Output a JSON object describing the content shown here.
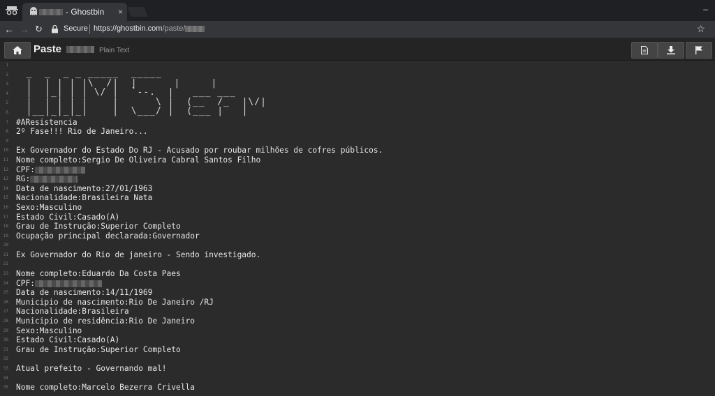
{
  "browser": {
    "tab_title": "- Ghostbin",
    "tab_close": "×",
    "window_controls": "_",
    "secure_label": "Secure",
    "url_host": "https://ghostbin.com",
    "url_path": "/paste/"
  },
  "header": {
    "title": "Paste",
    "language": "Plain Text"
  },
  "ascii_art": [
    "  _  _  _ _ _____  _____",
    "  |  | | | |\\  /|  |      |     |",
    "  |  |_| | | \\/ |  `--.  |   ___ ___",
    "  |  | | | |    |      \\ |  (__  /_  |\\/|",
    "  |__|_|_|_|    |  \\___/ |  (___ |   |"
  ],
  "lines": [
    {
      "n": "1",
      "t": ""
    },
    {
      "n": "2",
      "t": ""
    },
    {
      "n": "3",
      "t": ""
    },
    {
      "n": "4",
      "t": ""
    },
    {
      "n": "5",
      "t": ""
    },
    {
      "n": "6",
      "t": ""
    },
    {
      "n": "7",
      "t": "#AResistencia"
    },
    {
      "n": "8",
      "t": "2º Fase!!! Rio de Janeiro..."
    },
    {
      "n": "9",
      "t": ""
    },
    {
      "n": "10",
      "t": "Ex Governador do Estado Do RJ - Acusado por roubar milhões de cofres públicos."
    },
    {
      "n": "11",
      "t": "Nome completo:Sergio De Oliveira Cabral Santos Filho"
    },
    {
      "n": "12",
      "t": "CPF:",
      "redact": 72
    },
    {
      "n": "13",
      "t": "RG:",
      "redact": 68
    },
    {
      "n": "14",
      "t": "Data de nascimento:27/01/1963"
    },
    {
      "n": "15",
      "t": "Nacionalidade:Brasileira Nata"
    },
    {
      "n": "16",
      "t": "Sexo:Masculino"
    },
    {
      "n": "17",
      "t": "Estado Civil:Casado(A)"
    },
    {
      "n": "18",
      "t": "Grau de Instrução:Superior Completo"
    },
    {
      "n": "19",
      "t": "Ocupação principal declarada:Governador"
    },
    {
      "n": "20",
      "t": ""
    },
    {
      "n": "21",
      "t": "Ex Governador do Rio de janeiro - Sendo investigado."
    },
    {
      "n": "22",
      "t": ""
    },
    {
      "n": "23",
      "t": "Nome completo:Eduardo Da Costa Paes"
    },
    {
      "n": "24",
      "t": "CPF:",
      "redact": 96
    },
    {
      "n": "25",
      "t": "Data de nascimento:14/11/1969"
    },
    {
      "n": "26",
      "t": "Municipio de nascimento:Rio De Janeiro /RJ"
    },
    {
      "n": "27",
      "t": "Nacionalidade:Brasileira"
    },
    {
      "n": "28",
      "t": "Municipio de residência:Rio De Janeiro"
    },
    {
      "n": "29",
      "t": "Sexo:Masculino"
    },
    {
      "n": "30",
      "t": "Estado Civil:Casado(A)"
    },
    {
      "n": "31",
      "t": "Grau de Instrução:Superior Completo"
    },
    {
      "n": "32",
      "t": ""
    },
    {
      "n": "33",
      "t": "Atual prefeito - Governando mal!"
    },
    {
      "n": "34",
      "t": ""
    },
    {
      "n": "35",
      "t": "Nome completo:Marcelo Bezerra Crivella"
    }
  ]
}
